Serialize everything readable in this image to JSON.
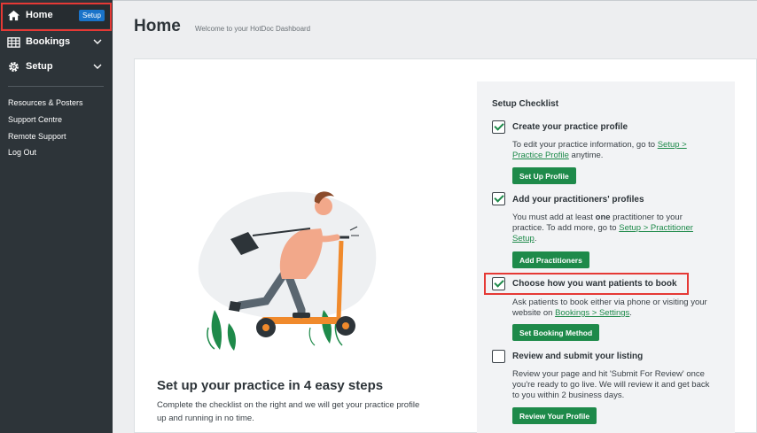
{
  "sidebar": {
    "home": {
      "label": "Home",
      "badge": "Setup"
    },
    "bookings": {
      "label": "Bookings"
    },
    "setup": {
      "label": "Setup"
    },
    "links": [
      "Resources & Posters",
      "Support Centre",
      "Remote Support",
      "Log Out"
    ]
  },
  "header": {
    "title": "Home",
    "subtitle": "Welcome to your HotDoc Dashboard"
  },
  "main": {
    "heading": "Set up your practice in 4 easy steps",
    "text": "Complete the checklist on the right and we will get your practice profile up and running in no time."
  },
  "checklist": {
    "title": "Setup Checklist",
    "items": [
      {
        "title": "Create your practice profile",
        "checked": true,
        "desc_before": "To edit your practice information, go to ",
        "desc_link": "Setup > Practice Profile",
        "desc_after": " anytime.",
        "button": "Set Up Profile"
      },
      {
        "title": "Add your practitioners' profiles",
        "checked": true,
        "desc_before": "You must add at least ",
        "desc_bold": "one",
        "desc_mid": " practitioner to your practice. To add more, go to ",
        "desc_link": "Setup > Practitioner Setup",
        "desc_after": ".",
        "button": "Add Practitioners"
      },
      {
        "title": "Choose how you want patients to book",
        "checked": true,
        "desc_before": "Ask patients to book either via phone or visiting your website on ",
        "desc_link": "Bookings > Settings",
        "desc_after": ".",
        "button": "Set Booking Method"
      },
      {
        "title": "Review and submit your listing",
        "checked": false,
        "desc_before": "Review your page and hit 'Submit For Review' once you're ready to go live. We will review it and get back to you within 2 business days.",
        "button": "Review Your Profile"
      }
    ]
  },
  "colors": {
    "sidebar": "#2d3439",
    "accent_green": "#1e8a4a",
    "badge_blue": "#1a73c9",
    "highlight_red": "#e53935",
    "illustration_orange": "#f08a2c"
  }
}
